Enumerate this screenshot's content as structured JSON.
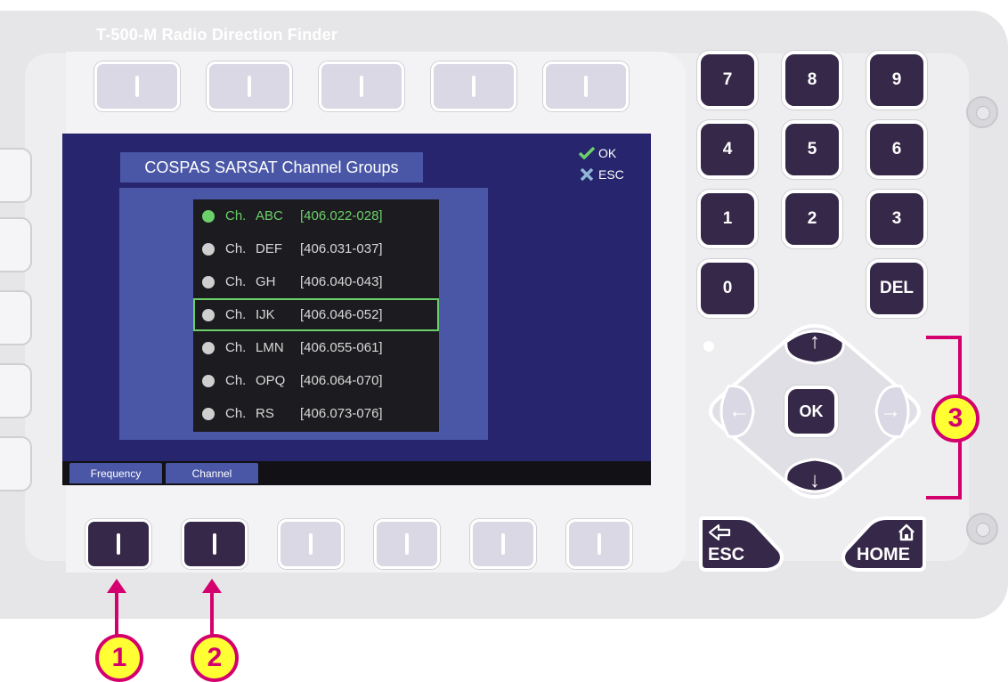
{
  "device": {
    "title": "T-500-M Radio Direction Finder"
  },
  "screen": {
    "title": "COSPAS SARSAT Channel Groups",
    "ok_hint": "OK",
    "esc_hint": "ESC",
    "rows": [
      {
        "prefix": "Ch.",
        "group": "ABC",
        "range": "[406.022-028]"
      },
      {
        "prefix": "Ch.",
        "group": "DEF",
        "range": "[406.031-037]"
      },
      {
        "prefix": "Ch.",
        "group": "GH",
        "range": "[406.040-043]"
      },
      {
        "prefix": "Ch.",
        "group": "IJK",
        "range": "[406.046-052]"
      },
      {
        "prefix": "Ch.",
        "group": "LMN",
        "range": "[406.055-061]"
      },
      {
        "prefix": "Ch.",
        "group": "OPQ",
        "range": "[406.064-070]"
      },
      {
        "prefix": "Ch.",
        "group": "RS",
        "range": "[406.073-076]"
      }
    ],
    "tabs": [
      "Frequency",
      "Channel"
    ]
  },
  "keypad": {
    "k7": "7",
    "k8": "8",
    "k9": "9",
    "k4": "4",
    "k5": "5",
    "k6": "6",
    "k1": "1",
    "k2": "2",
    "k3": "3",
    "k0": "0",
    "del": "DEL"
  },
  "dpad": {
    "ok": "OK",
    "up": "↑",
    "down": "↓",
    "left": "←",
    "right": "→"
  },
  "nav": {
    "esc_label": "ESC",
    "home_label": "HOME"
  },
  "annotations": {
    "one": "1",
    "two": "2",
    "three": "3"
  },
  "colors": {
    "accent_highlight": "#6bd06a",
    "screen_bg": "#26256e",
    "panel_blue": "#4a57a6",
    "key_dark": "#362848",
    "annotation_magenta": "#d4006e",
    "annotation_yellow": "#ffff33"
  }
}
